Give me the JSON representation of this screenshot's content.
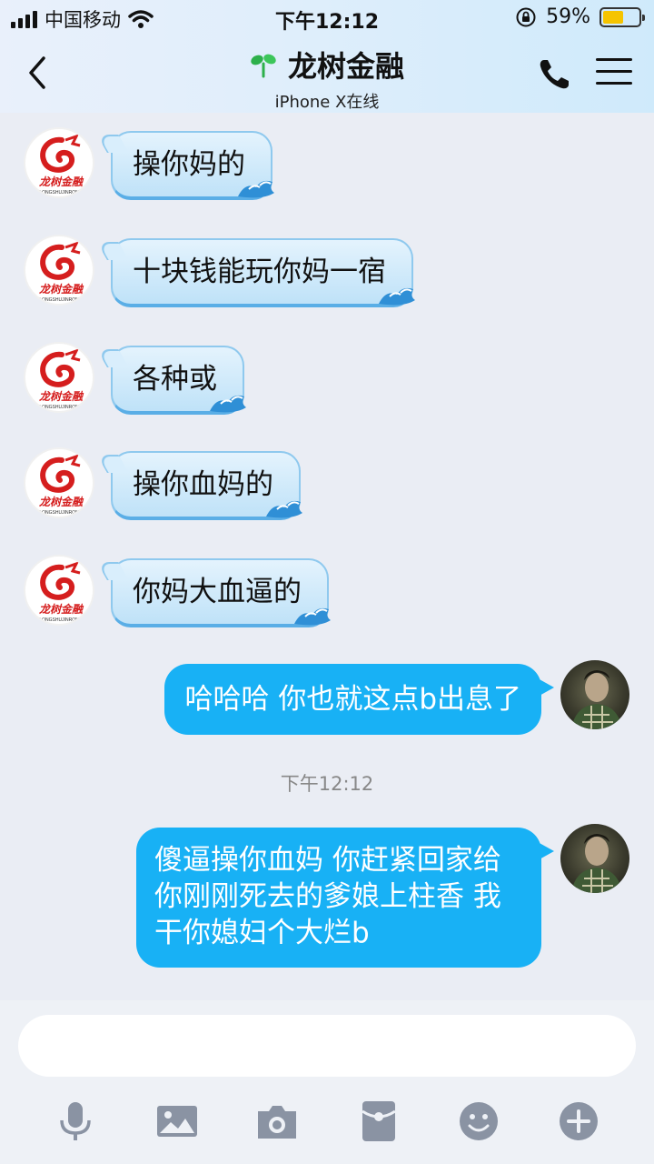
{
  "status_bar": {
    "carrier": "中国移动",
    "time": "下午12:12",
    "battery": "59%",
    "battery_level": 0.59
  },
  "header": {
    "title": "龙树金融",
    "subtitle": "iPhone X在线"
  },
  "messages": [
    {
      "side": "left",
      "text": "操你妈的"
    },
    {
      "side": "left",
      "text": "十块钱能玩你妈一宿"
    },
    {
      "side": "left",
      "text": "各种或"
    },
    {
      "side": "left",
      "text": "操你血妈的"
    },
    {
      "side": "left",
      "text": "你妈大血逼的"
    },
    {
      "side": "right",
      "text": "哈哈哈 你也就这点b出息了"
    },
    {
      "side": "right",
      "lines": [
        "傻逼操你血妈 你赶紧回家给",
        "你刚刚死去的爹娘上柱香 我",
        "干你媳妇个大烂b"
      ]
    }
  ],
  "timestamp": "下午12:12",
  "avatar_logo": {
    "text": "龙树金融",
    "subtext": "LONGSHUJINRONG"
  },
  "colors": {
    "sent_bubble": "#18b1f5",
    "received_bubble": "#bfe2f8",
    "icon_gray": "#8a93a3"
  },
  "toolbar": {
    "icons": [
      "microphone-icon",
      "image-icon",
      "camera-icon",
      "red-packet-icon",
      "emoji-icon",
      "plus-icon"
    ]
  }
}
